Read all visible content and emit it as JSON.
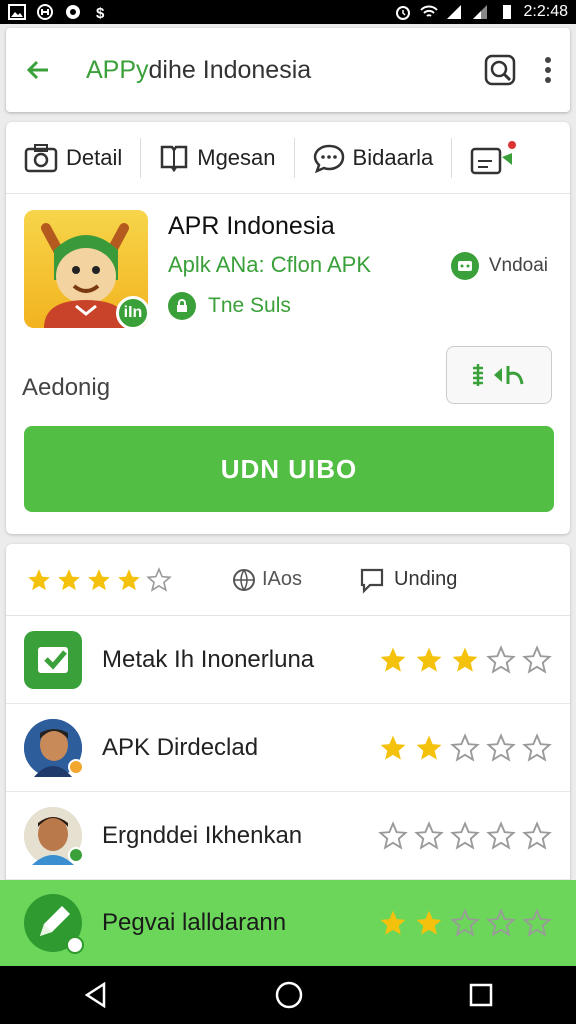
{
  "status": {
    "time": "2:2:48"
  },
  "appbar": {
    "title_prefix": "APPy",
    "title_rest": "dihe Indonesia"
  },
  "tabs": [
    {
      "label": "Detail",
      "icon": "camera-icon"
    },
    {
      "label": "Mgesan",
      "icon": "book-icon"
    },
    {
      "label": "Bidaarla",
      "icon": "chat-icon"
    }
  ],
  "app": {
    "name": "APR Indonesia",
    "subtitle": "Aplk ANa: Cflon APK",
    "meta": "Tne Suls",
    "vendor": "Vndoai",
    "badge": "iIn",
    "status_text": "Aedonig",
    "install_label": "UDN UIBO"
  },
  "rating_bar": {
    "count_text": "IAos",
    "comments_label": "Unding",
    "stars_filled": 4,
    "stars_total": 5
  },
  "list": [
    {
      "label": "Metak Ih Inonerluna",
      "stars": 3
    },
    {
      "label": "APK Dirdeclad",
      "stars": 2
    },
    {
      "label": "Ergnddei Ikhenkan",
      "stars": 0
    },
    {
      "label": "Pegvai lalldarann",
      "stars": 2
    }
  ],
  "colors": {
    "accent": "#3aa03a",
    "button": "#52be43",
    "star": "#f4c20d"
  }
}
